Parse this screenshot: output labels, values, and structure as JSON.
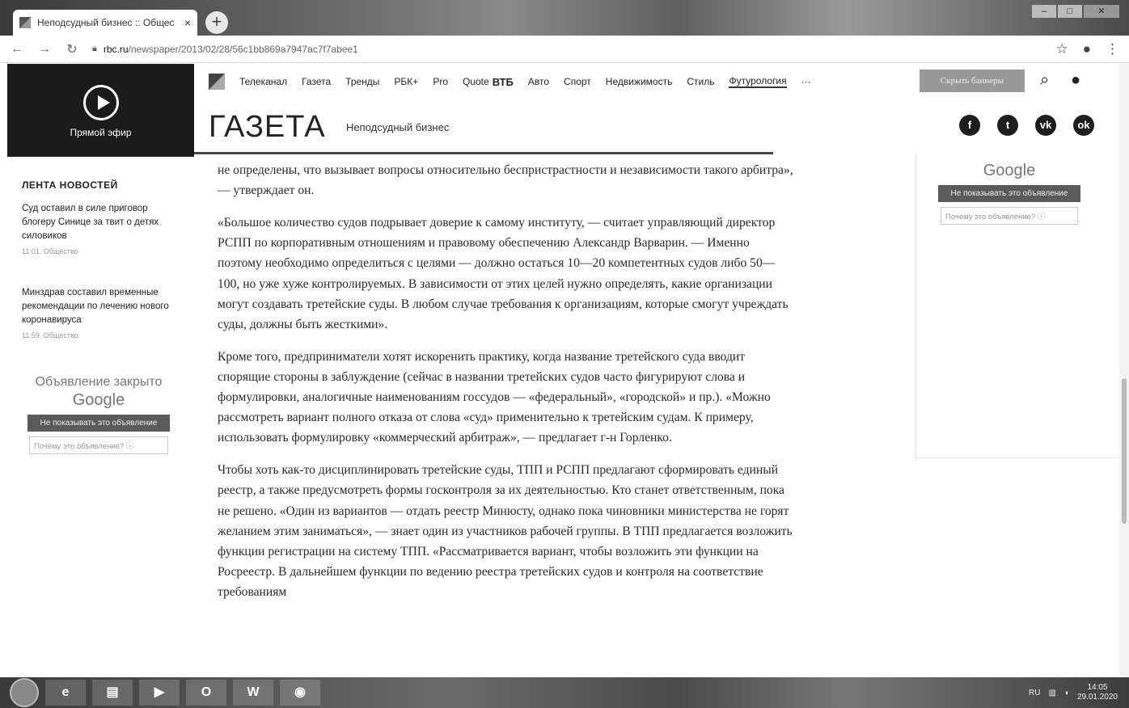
{
  "browser": {
    "tab_title": "Неподсудный бизнес :: Общес",
    "tab_close": "×",
    "new_tab": "+",
    "url_host": "rbc.ru",
    "url_path": "/newspaper/2013/02/28/56c1bb869a7947ac7f7abee1"
  },
  "live": {
    "label": "Прямой эфир"
  },
  "topnav": {
    "items": [
      "Телеканал",
      "Газета",
      "Тренды",
      "РБК+",
      "Pro",
      "Quote",
      "ВТБ",
      "Авто",
      "Спорт",
      "Недвижимость",
      "Стиль",
      "Футурология",
      "···"
    ],
    "banner_button": "Скрыть баннеры"
  },
  "header": {
    "section": "ГАЗЕТА",
    "rubric": "Неподсудный бизнес"
  },
  "social": [
    "f",
    "t",
    "vk",
    "ok"
  ],
  "feed": {
    "title": "ЛЕНТА НОВОСТЕЙ",
    "items": [
      {
        "text": "Суд оставил в силе приговор блогеру Синице за твит о детях силовиков",
        "meta": "11:01, Общество"
      },
      {
        "text": "Минздрав составил временные рекомендации по лечению нового коронавируса",
        "meta": "11:59, Общество"
      }
    ]
  },
  "ad_left": {
    "title": "Объявление закрыто",
    "brand": "Google",
    "button": "Не показывать это объявление",
    "why": "Почему это объявление? ⓘ"
  },
  "ad_right": {
    "brand": "Google",
    "button": "Не показывать это объявление",
    "why": "Почему это объявление? ⓘ"
  },
  "article": {
    "paragraphs": [
      "не определены, что вызывает вопросы относительно беспристрастности и независимости такого арбитра», — утверждает он.",
      "«Большое количество судов подрывает доверие к самому институту, — считает управляющий директор РСПП по корпоративным отношениям и правовому обеспечению Александр Варварин. — Именно поэтому необходимо определиться с целями — должно остаться 10—20 компетентных судов либо 50—100, но уже хуже контролируемых. В зависимости от этих целей нужно определять, какие организации могут создавать третейские суды. В любом случае требования к организациям, которые смогут учреждать суды, должны быть жесткими».",
      "Кроме того, предприниматели хотят искоренить практику, когда название третейского суда вводит спорящие стороны в заблуждение (сейчас в названии третейских судов часто фигурируют слова и формулировки, аналогичные наименованиям госсудов — «федеральный», «городской» и пр.). «Можно рассмотреть вариант полного отказа от слова «суд» применительно к третейским судам. К примеру, использовать формулировку «коммерческий арбитраж», — предлагает г-н Горленко.",
      "Чтобы хоть как-то дисциплинировать третейские суды, ТПП и РСПП предлагают сформировать единый реестр, а также предусмотреть формы госконтроля за их деятельностью. Кто станет ответственным, пока не решено. «Один из вариантов — отдать реестр Минюсту, однако пока чиновники министерства не горят желанием этим заниматься», — знает один из участников рабочей группы. В ТПП предлагается возложить функции регистрации на систему ТПП. «Рассматривается вариант, чтобы возложить эти функции на Росреестр. В дальнейшем функции по ведению реестра третейских судов и контроля на соответствие требованиям"
    ]
  },
  "taskbar": {
    "apps": [
      "e",
      "▤",
      "▶",
      "O",
      "W",
      "◉"
    ],
    "lang": "RU",
    "time": "14:05",
    "date": "29.01.2020"
  }
}
